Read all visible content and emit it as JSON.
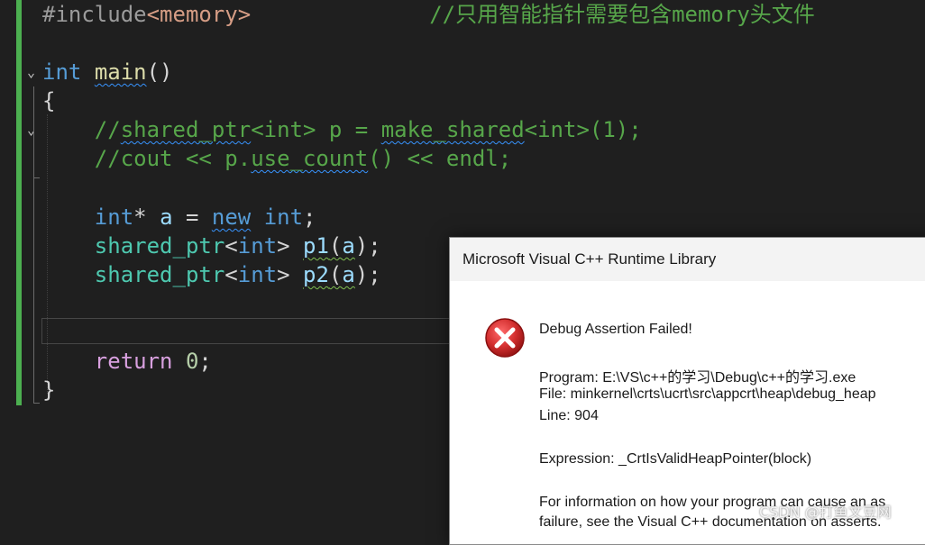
{
  "editor": {
    "line1": {
      "directive": "#include",
      "header": "<memory>",
      "comment": "//只用智能指针需要包含memory头文件"
    },
    "line_main": {
      "type": "int",
      "name": "main",
      "parens": "()"
    },
    "open_brace": "{",
    "comment1": {
      "prefix": "//",
      "ident": "shared_ptr",
      "mid": "<int> p = ",
      "func": "make_shared",
      "suffix": "<int>(1);"
    },
    "comment2": {
      "prefix": "//cout << p.",
      "func": "use_count",
      "suffix": "() << endl;"
    },
    "line_new": {
      "type": "int",
      "star": "*",
      "var": "a",
      "eq": " = ",
      "kw_new": "new",
      "type2": "int",
      "semi": ";"
    },
    "line_p1": {
      "type": "shared_ptr",
      "lt": "<",
      "targ": "int",
      "gt": "> ",
      "var": "p1",
      "open": "(",
      "arg": "a",
      "close": ");"
    },
    "line_p2": {
      "type": "shared_ptr",
      "lt": "<",
      "targ": "int",
      "gt": "> ",
      "var": "p2",
      "open": "(",
      "arg": "a",
      "close": ");"
    },
    "line_return": {
      "kw": "return",
      "value": "0",
      "semi": ";"
    },
    "close_brace": "}"
  },
  "dialog": {
    "title": "Microsoft Visual C++ Runtime Library",
    "heading": "Debug Assertion Failed!",
    "program": "Program: E:\\VS\\c++的学习\\Debug\\c++的学习.exe",
    "file": "File: minkernel\\crts\\ucrt\\src\\appcrt\\heap\\debug_heap",
    "line": "Line: 904",
    "expression": "Expression: _CrtIsValidHeapPointer(block)",
    "info1": "For information on how your program can cause an as",
    "info2": "failure, see the Visual C++ documentation on asserts."
  },
  "watermark": "CSDN @打鱼文豆网",
  "colors": {
    "editor_bg": "#1f1f1f",
    "change_bar": "#4caf50",
    "keyword": "#569cd6",
    "function": "#dcdcaa",
    "type": "#4ec9b0",
    "comment": "#57a64a",
    "error_red": "#d32f2f"
  },
  "icons": {
    "fold_open": "chevron-down-icon",
    "dialog_icon": "error-icon"
  }
}
